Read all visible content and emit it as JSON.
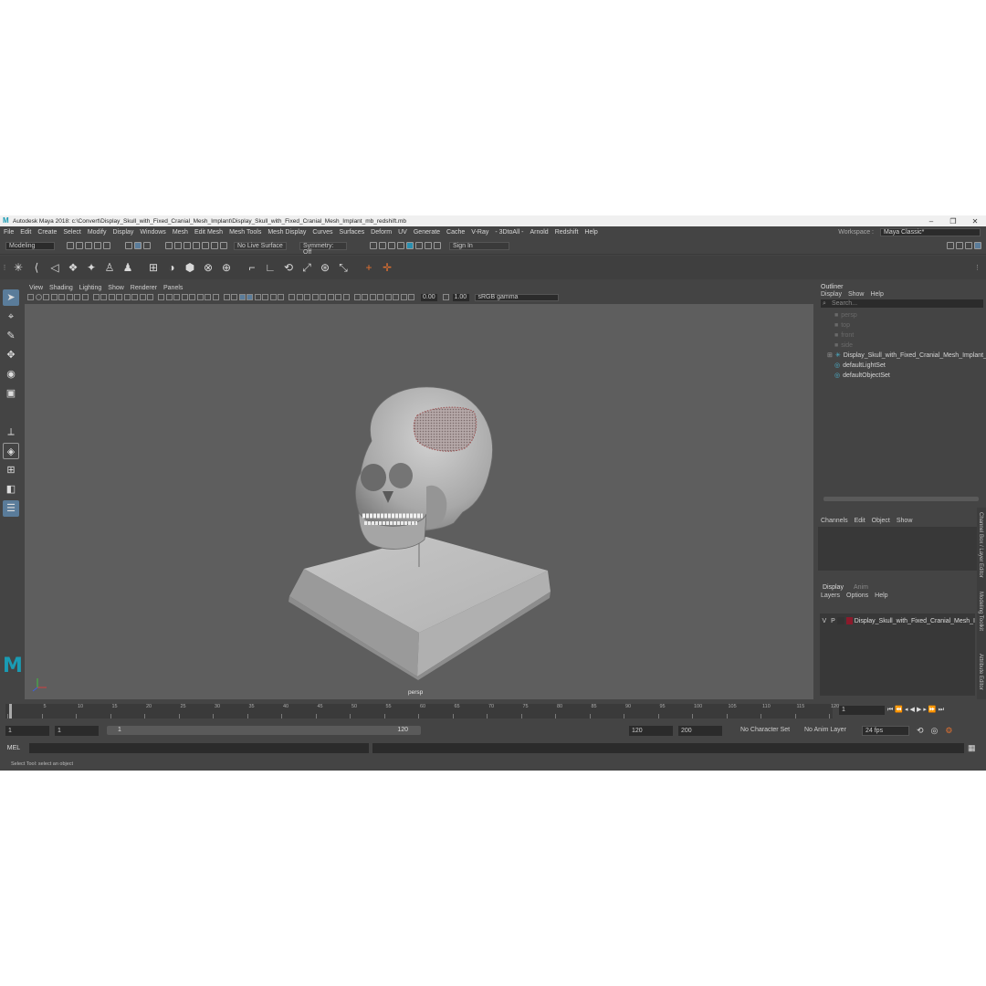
{
  "window": {
    "title": "Autodesk Maya 2018: c:\\Convert\\Display_Skull_with_Fixed_Cranial_Mesh_Implant\\Display_Skull_with_Fixed_Cranial_Mesh_Implant_mb_redshift.mb"
  },
  "menu": [
    "File",
    "Edit",
    "Create",
    "Select",
    "Modify",
    "Display",
    "Windows",
    "Mesh",
    "Edit Mesh",
    "Mesh Tools",
    "Mesh Display",
    "Curves",
    "Surfaces",
    "Deform",
    "UV",
    "Generate",
    "Cache",
    "V-Ray",
    "- 3DtoAll -",
    "Arnold",
    "Redshift",
    "Help"
  ],
  "workspace": {
    "label": "Workspace :",
    "value": "Maya Classic*"
  },
  "status_line": {
    "mode": "Modeling",
    "live_surface": "No Live Surface",
    "symmetry": "Symmetry: Off",
    "sign_in": "Sign In"
  },
  "viewport": {
    "menu": [
      "View",
      "Shading",
      "Lighting",
      "Show",
      "Renderer",
      "Panels"
    ],
    "exposure": "0.00",
    "gamma": "1.00",
    "colorspace": "sRGB gamma",
    "camera_label": "persp",
    "logo": "M"
  },
  "outliner": {
    "title": "Outliner",
    "menu": [
      "Display",
      "Show",
      "Help"
    ],
    "search": "Search...",
    "items": [
      {
        "label": "persp",
        "dim": true
      },
      {
        "label": "top",
        "dim": true
      },
      {
        "label": "front",
        "dim": true
      },
      {
        "label": "side",
        "dim": true
      },
      {
        "label": "Display_Skull_with_Fixed_Cranial_Mesh_Implant_n",
        "dim": false
      },
      {
        "label": "defaultLightSet",
        "dim": false
      },
      {
        "label": "defaultObjectSet",
        "dim": false
      }
    ]
  },
  "channel_box": {
    "menu": [
      "Channels",
      "Edit",
      "Object",
      "Show"
    ]
  },
  "layer_editor": {
    "tabs": [
      "Display",
      "Anim"
    ],
    "menu": [
      "Layers",
      "Options",
      "Help"
    ],
    "layer": {
      "v": "V",
      "p": "P",
      "name": "Display_Skull_with_Fixed_Cranial_Mesh_I",
      "color": "#8b1a2b"
    }
  },
  "side_tabs": [
    "Channel Box / Layer Editor",
    "Modeling Toolkit",
    "Attribute Editor"
  ],
  "timeline": {
    "ticks": [
      "1",
      "5",
      "10",
      "15",
      "20",
      "25",
      "30",
      "35",
      "40",
      "45",
      "50",
      "55",
      "60",
      "65",
      "70",
      "75",
      "80",
      "85",
      "90",
      "95",
      "100",
      "105",
      "110",
      "115",
      "120"
    ],
    "current": "1"
  },
  "range": {
    "start": "1",
    "playback_start": "1",
    "slider_start": "1",
    "slider_end": "120",
    "playback_end": "120",
    "end": "200",
    "character": "No Character Set",
    "anim_layer": "No Anim Layer",
    "fps": "24 fps"
  },
  "command": {
    "lang": "MEL"
  },
  "help_line": "Select Tool: select an object"
}
